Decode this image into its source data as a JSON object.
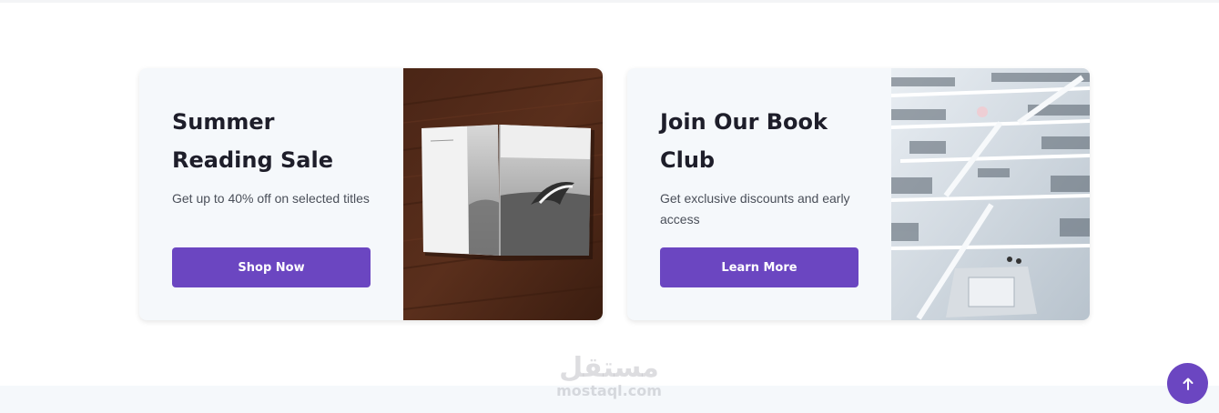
{
  "promos": [
    {
      "title": "Summer Reading Sale",
      "description": "Get up to 40% off on selected titles",
      "button_label": "Shop Now",
      "image": "open-book-on-wooden-table"
    },
    {
      "title": "Join Our Book Club",
      "description": "Get exclusive discounts and early access",
      "button_label": "Learn More",
      "image": "multi-level-library-atrium"
    }
  ],
  "watermark": {
    "arabic": "مستقل",
    "latin": "mostaql.com"
  },
  "scroll_top": {
    "icon": "arrow-up-icon"
  },
  "colors": {
    "accent": "#6b46c1",
    "card_background": "#f5f8fb",
    "title": "#1e1e2a",
    "text": "#4a4f59"
  }
}
